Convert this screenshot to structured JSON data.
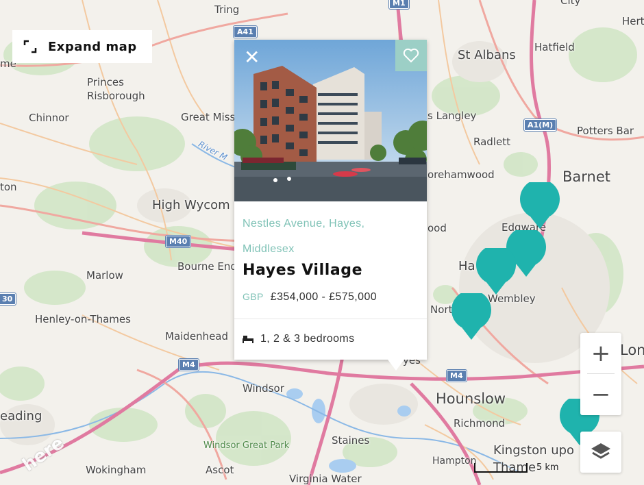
{
  "expand_map": {
    "label": "Expand map",
    "icon": "expand-icon"
  },
  "popup": {
    "address": "Nestles Avenue, Hayes, Middlesex",
    "name": "Hayes Village",
    "currency": "GBP",
    "price": "£354,000 - £575,000",
    "bedrooms": "1, 2 & 3 bedrooms",
    "close_icon": "close-icon",
    "favourite_icon": "heart-icon",
    "bed_icon": "bed-icon"
  },
  "controls": {
    "zoom_in": "+",
    "zoom_out": "−",
    "layers_icon": "layers-icon"
  },
  "scale": {
    "label": "5 km"
  },
  "watermark": {
    "text": "here"
  },
  "colors": {
    "marker": "#1fb3ad",
    "accent": "#7fc2b6",
    "motorway": "#e07aa0",
    "road": "#f0a8a0"
  },
  "places": [
    {
      "id": "tring",
      "label": "Tring"
    },
    {
      "id": "st-albans",
      "label": "St Albans"
    },
    {
      "id": "hatfield",
      "label": "Hatfield"
    },
    {
      "id": "hert",
      "label": "Hert"
    },
    {
      "id": "city",
      "label": "City"
    },
    {
      "id": "princes-risborough",
      "label": "Princes\nRisborough"
    },
    {
      "id": "chinnor",
      "label": "Chinnor"
    },
    {
      "id": "great-missenden",
      "label": "Great Miss"
    },
    {
      "id": "kings-langley",
      "label": "s Langley"
    },
    {
      "id": "potters-bar",
      "label": "Potters Bar"
    },
    {
      "id": "radlett",
      "label": "Radlett"
    },
    {
      "id": "barnet",
      "label": "Barnet"
    },
    {
      "id": "borehamwood",
      "label": "orehamwood"
    },
    {
      "id": "edgware",
      "label": "Edgware"
    },
    {
      "id": "high-wycombe",
      "label": "High Wycom"
    },
    {
      "id": "ton",
      "label": "ton"
    },
    {
      "id": "me",
      "label": "me"
    },
    {
      "id": "wood",
      "label": "ood"
    },
    {
      "id": "harrow",
      "label": "Ha"
    },
    {
      "id": "wembley",
      "label": "Wembley"
    },
    {
      "id": "bourne-end",
      "label": "Bourne End"
    },
    {
      "id": "marlow",
      "label": "Marlow"
    },
    {
      "id": "henley",
      "label": "Henley-on-Thames"
    },
    {
      "id": "north",
      "label": "Nort"
    },
    {
      "id": "maidenhead",
      "label": "Maidenhead"
    },
    {
      "id": "hayes",
      "label": "yes"
    },
    {
      "id": "lon",
      "label": "Lon"
    },
    {
      "id": "windsor",
      "label": "Windsor"
    },
    {
      "id": "hounslow",
      "label": "Hounslow"
    },
    {
      "id": "reading",
      "label": "eading"
    },
    {
      "id": "richmond",
      "label": "Richmond"
    },
    {
      "id": "staines",
      "label": "Staines"
    },
    {
      "id": "windsor-great-park",
      "label": "Windsor Great Park"
    },
    {
      "id": "hampton",
      "label": "Hampton"
    },
    {
      "id": "kingston",
      "label": "Kingston upo"
    },
    {
      "id": "thames",
      "label": "Thame"
    },
    {
      "id": "wokingham",
      "label": "Wokingham"
    },
    {
      "id": "ascot",
      "label": "Ascot"
    },
    {
      "id": "virginia-water",
      "label": "Virginia Water"
    }
  ],
  "road_shields": [
    "M1",
    "A41",
    "A1(M)",
    "M40",
    "M4",
    "M4",
    "30"
  ],
  "river_label": "River M"
}
